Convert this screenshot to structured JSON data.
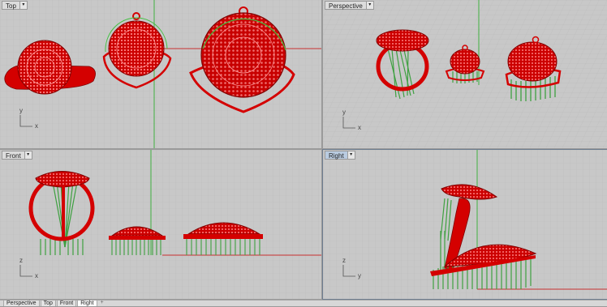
{
  "viewports": [
    {
      "key": "top",
      "label": "Top",
      "axis_x": "x",
      "axis_y": "y"
    },
    {
      "key": "perspective",
      "label": "Perspective",
      "axis_x": "x",
      "axis_y": "y"
    },
    {
      "key": "front",
      "label": "Front",
      "axis_x": "x",
      "axis_y": "z"
    },
    {
      "key": "right",
      "label": "Right",
      "axis_x": "y",
      "axis_y": "z"
    }
  ],
  "active_viewport": "Right",
  "viewport_menu_icon": "dropdown-arrow-icon",
  "bottom_tabs": [
    "Perspective",
    "Top",
    "Front",
    "Right"
  ],
  "selected_tab": "Right",
  "add_tab_icon": "plus-icon",
  "colors": {
    "viewport_bg": "#c8c8c8",
    "grid": "#b8b8b8",
    "object": "#d80000",
    "supports": "#3ea040",
    "x_axis": "#c83030",
    "y_axis": "#40b040"
  }
}
